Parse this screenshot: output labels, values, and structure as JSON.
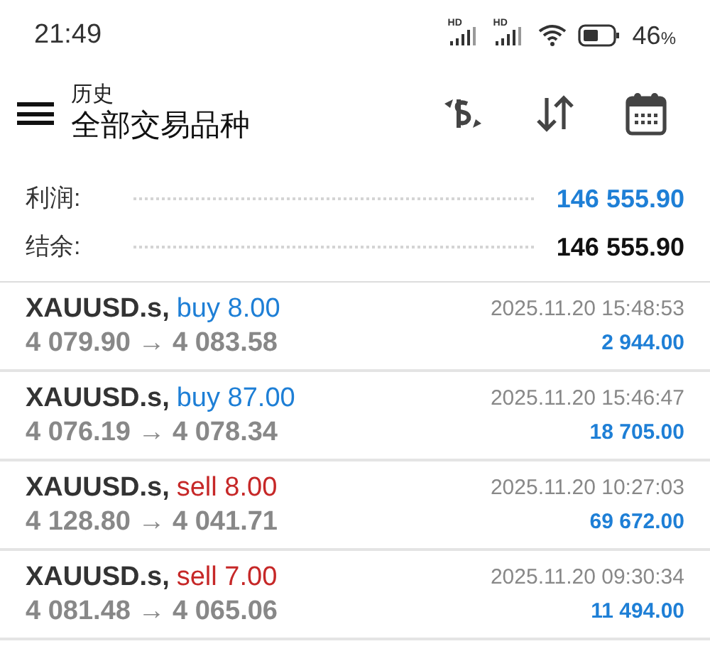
{
  "status_bar": {
    "time": "21:49",
    "signals": [
      {
        "label": "HD"
      },
      {
        "label": "HD"
      }
    ],
    "battery_percent": "46",
    "percent_sign": "%"
  },
  "header": {
    "subtitle": "历史",
    "title": "全部交易品种"
  },
  "summary": [
    {
      "label": "利润:",
      "value": "146 555.90",
      "kind": "profit"
    },
    {
      "label": "结余:",
      "value": "146 555.90",
      "kind": "balance"
    }
  ],
  "trades": [
    {
      "symbol": "XAUUSD.s,",
      "side": "buy",
      "volume": "8.00",
      "prices": "4 079.90 → 4 083.58",
      "time": "2025.11.20 15:48:53",
      "profit": "2 944.00"
    },
    {
      "symbol": "XAUUSD.s,",
      "side": "buy",
      "volume": "87.00",
      "prices": "4 076.19 → 4 078.34",
      "time": "2025.11.20 15:46:47",
      "profit": "18 705.00"
    },
    {
      "symbol": "XAUUSD.s,",
      "side": "sell",
      "volume": "8.00",
      "prices": "4 128.80 → 4 041.71",
      "time": "2025.11.20 10:27:03",
      "profit": "69 672.00"
    },
    {
      "symbol": "XAUUSD.s,",
      "side": "sell",
      "volume": "7.00",
      "prices": "4 081.48 → 4 065.06",
      "time": "2025.11.20 09:30:34",
      "profit": "11 494.00"
    }
  ]
}
